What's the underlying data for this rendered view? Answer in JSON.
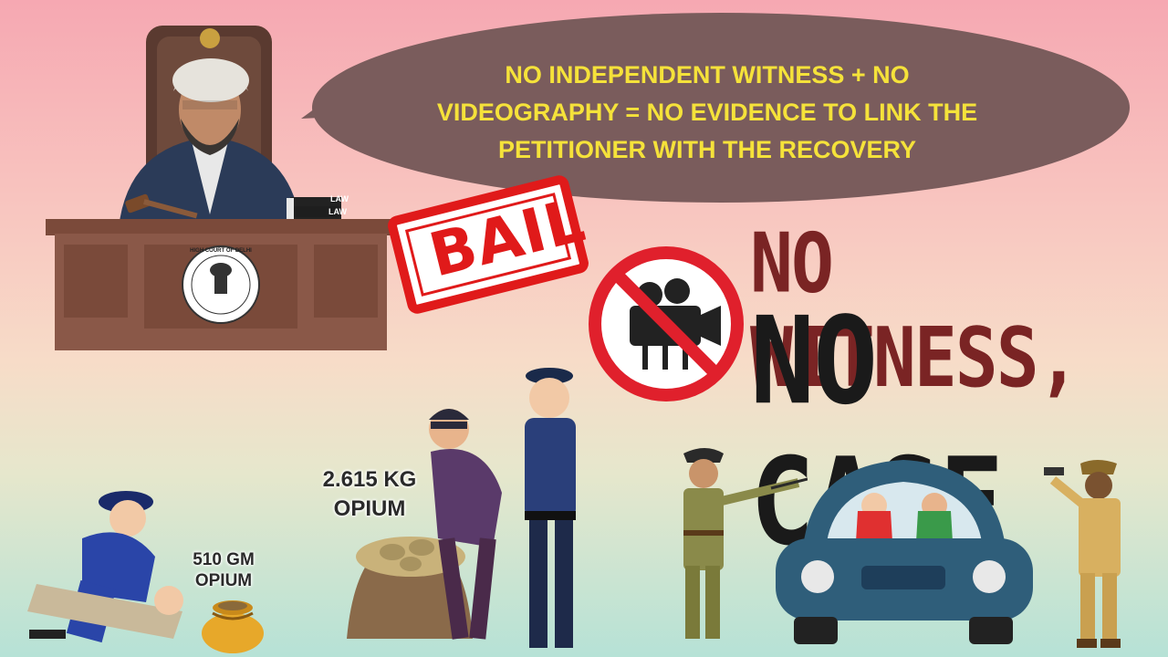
{
  "speech_bubble": {
    "text": "NO INDEPENDENT WITNESS + NO VIDEOGRAPHY = NO EVIDENCE TO LINK THE PETITIONER WITH THE RECOVERY"
  },
  "stamp": {
    "text": "BAIL"
  },
  "headline": {
    "line1": "NO WITNESS,",
    "line2": "NO CASE"
  },
  "desk_emblem": {
    "text": "HIGH COURT OF DELHI"
  },
  "books": {
    "label1": "LAW",
    "label2": "LAW"
  },
  "quantities": {
    "large": "2.615 KG OPIUM",
    "small": "510 GM OPIUM"
  },
  "icons": [
    "no-camera-icon",
    "judge",
    "gavel-icon",
    "police-officer",
    "thief",
    "car",
    "opium-sack",
    "money-bag"
  ],
  "colors": {
    "bubble": "#7a5c5c",
    "bubble_text": "#f5e23a",
    "stamp": "#e01a1a",
    "prohibition": "#e0202c",
    "headline_top": "#7a2424",
    "headline_bottom": "#1a1a1a"
  }
}
